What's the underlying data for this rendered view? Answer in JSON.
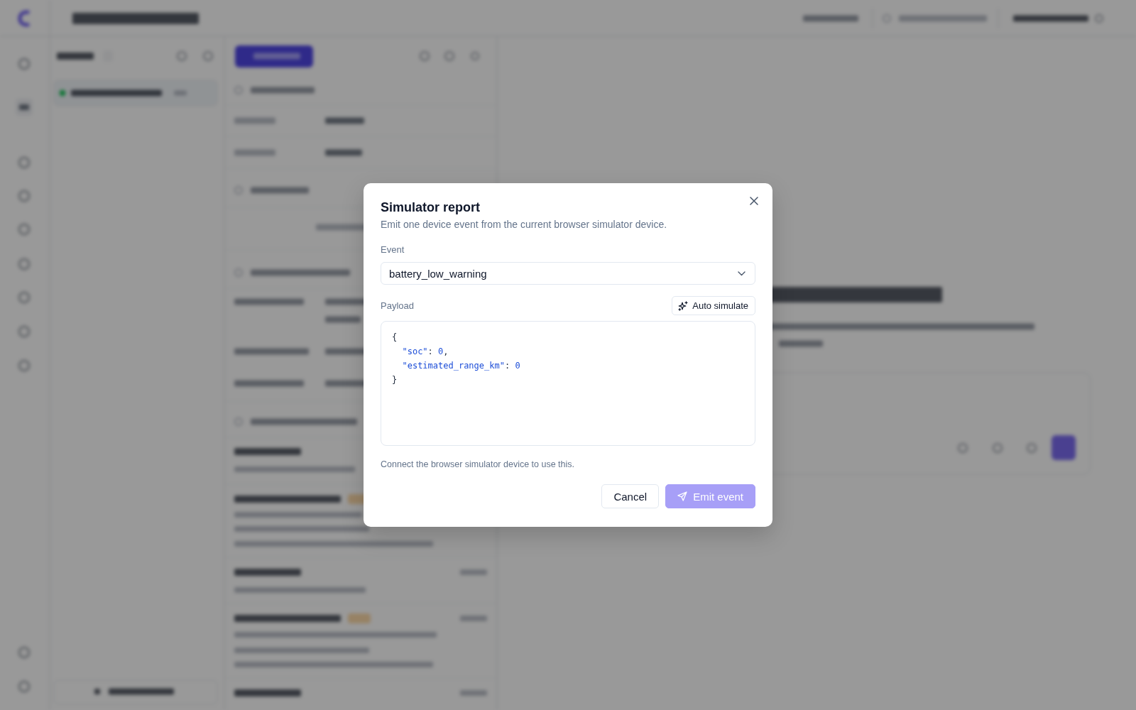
{
  "dialog": {
    "title": "Simulator report",
    "description": "Emit one device event from the current browser simulator device.",
    "event_field": {
      "label": "Event",
      "value": "battery_low_warning"
    },
    "payload_field": {
      "label": "Payload",
      "action": {
        "label": "Auto simulate"
      },
      "value": "{\n  \"soc\": 0,\n  \"estimated_range_km\": 0\n}"
    },
    "hint": "Connect the browser simulator device to use this.",
    "buttons": [
      {
        "label": "Cancel",
        "kind": "secondary",
        "disabled": false
      },
      {
        "label": "Emit event",
        "kind": "primary",
        "disabled": true
      }
    ]
  }
}
